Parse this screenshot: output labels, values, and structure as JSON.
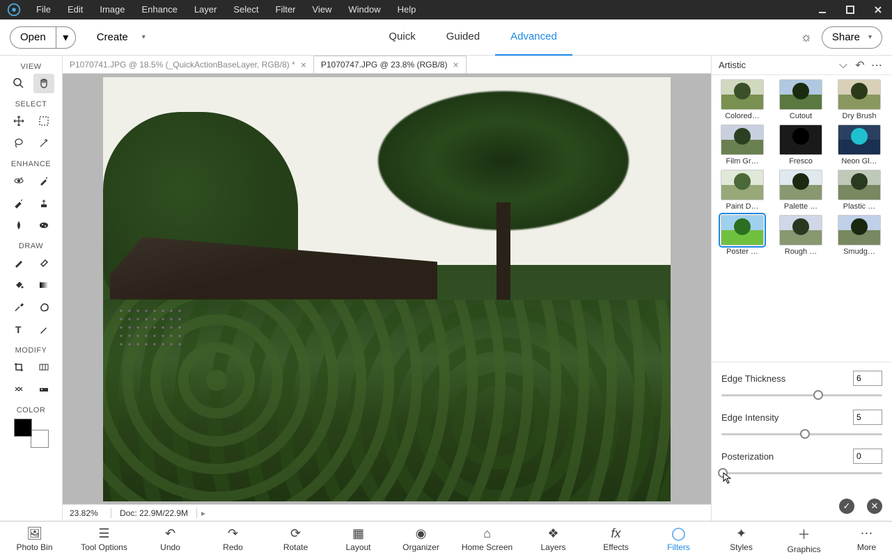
{
  "menubar": [
    "File",
    "Edit",
    "Image",
    "Enhance",
    "Layer",
    "Select",
    "Filter",
    "View",
    "Window",
    "Help"
  ],
  "toolbar": {
    "open": "Open",
    "create": "Create",
    "modes": [
      "Quick",
      "Guided",
      "Advanced"
    ],
    "active_mode": 2,
    "share": "Share"
  },
  "docs": {
    "tabs": [
      {
        "title": "P1070741.JPG @ 18.5% (_QuickActionBaseLayer, RGB/8) *"
      },
      {
        "title": "P1070747.JPG @ 23.8% (RGB/8)"
      }
    ],
    "active": 1
  },
  "toolbox": {
    "sections": {
      "view": "VIEW",
      "select": "SELECT",
      "enhance": "ENHANCE",
      "draw": "DRAW",
      "modify": "MODIFY",
      "color": "COLOR"
    }
  },
  "right_panel": {
    "category": "Artistic",
    "filters": [
      "Colored…",
      "Cutout",
      "Dry Brush",
      "Film Gr…",
      "Fresco",
      "Neon Gl…",
      "Paint D…",
      "Palette …",
      "Plastic …",
      "Poster …",
      "Rough …",
      "Smudg…"
    ],
    "selected": 9,
    "controls": {
      "edge_thickness": {
        "label": "Edge Thickness",
        "value": "6",
        "pos": 60
      },
      "edge_intensity": {
        "label": "Edge Intensity",
        "value": "5",
        "pos": 52
      },
      "posterization": {
        "label": "Posterization",
        "value": "0",
        "pos": 1
      }
    }
  },
  "status": {
    "zoom": "23.82%",
    "doc": "Doc: 22.9M/22.9M"
  },
  "bottom": {
    "items": [
      "Photo Bin",
      "Tool Options",
      "Undo",
      "Redo",
      "Rotate",
      "Layout",
      "Organizer",
      "Home Screen",
      "Layers",
      "Effects",
      "Filters",
      "Styles",
      "Graphics",
      "More"
    ],
    "active": 10
  }
}
